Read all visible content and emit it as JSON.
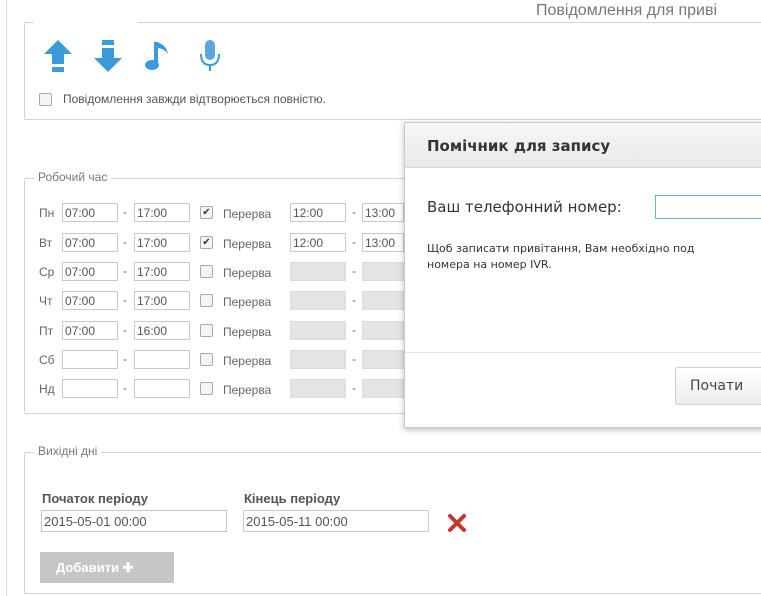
{
  "header": {
    "title": "Повідомлення для приві"
  },
  "toolbar": {
    "icons": [
      "arrow-up-icon",
      "arrow-down-icon",
      "music-note-icon",
      "microphone-icon"
    ],
    "full_play_checkbox_label": "Повідомлення завжди відтворюється повністю."
  },
  "work_hours": {
    "legend": "Робочий час",
    "break_label": "Перерва",
    "rows": [
      {
        "day": "Пн",
        "from": "07:00",
        "to": "17:00",
        "break_checked": true,
        "break_from": "12:00",
        "break_to": "13:00"
      },
      {
        "day": "Вт",
        "from": "07:00",
        "to": "17:00",
        "break_checked": true,
        "break_from": "12:00",
        "break_to": "13:00"
      },
      {
        "day": "Ср",
        "from": "07:00",
        "to": "17:00",
        "break_checked": false,
        "break_from": "",
        "break_to": ""
      },
      {
        "day": "Чт",
        "from": "07:00",
        "to": "17:00",
        "break_checked": false,
        "break_from": "",
        "break_to": ""
      },
      {
        "day": "Пт",
        "from": "07:00",
        "to": "16:00",
        "break_checked": false,
        "break_from": "",
        "break_to": ""
      },
      {
        "day": "Сб",
        "from": "",
        "to": "",
        "break_checked": false,
        "break_from": "",
        "break_to": ""
      },
      {
        "day": "Нд",
        "from": "",
        "to": "",
        "break_checked": false,
        "break_from": "",
        "break_to": ""
      }
    ]
  },
  "holidays": {
    "legend": "Вихідні дні",
    "start_header": "Початок періоду",
    "end_header": "Кінець періоду",
    "start_value": "2015-05-01 00:00",
    "end_value": "2015-05-11 00:00",
    "add_button": "Добавити ✚"
  },
  "dialog": {
    "title": "Помічник для запису",
    "phone_label": "Ваш телефонний номер:",
    "phone_value": "",
    "info_line1": "Щоб записати привітання, Вам необхідно под",
    "info_line2": "номера на номер IVR.",
    "start_button": "Почати"
  },
  "colors": {
    "arrow_blue": "#3b9ad9",
    "delete_red": "#c0392b",
    "disabled_input": "#e4e4e4"
  }
}
